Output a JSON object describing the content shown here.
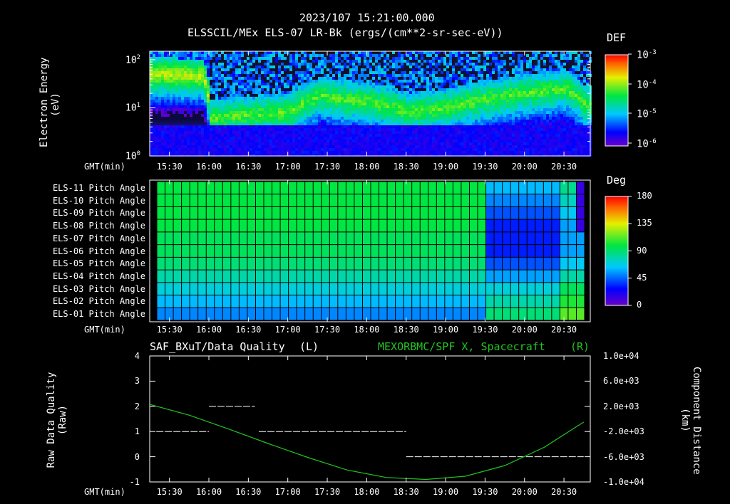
{
  "header": {
    "timestamp": "2023/107 15:21:00.000",
    "title": "ELSSCIL/MEx ELS-07 LR-Bk  (ergs/(cm**2-sr-sec-eV))"
  },
  "chart_data": [
    {
      "type": "heatmap",
      "title": "ELSSCIL/MEx ELS-07 LR-Bk  (ergs/(cm**2-sr-sec-eV))",
      "xlabel": "GMT(min)",
      "ylabel": "Electron Energy (eV)",
      "yscale": "log",
      "ylim": [
        1,
        150
      ],
      "y_ticks": [
        "10^2",
        "10^1",
        "10^0"
      ],
      "x_ticks": [
        "15:30",
        "16:00",
        "16:30",
        "17:00",
        "17:30",
        "18:00",
        "18:30",
        "19:00",
        "19:30",
        "20:00",
        "20:30"
      ],
      "colorbar": {
        "label": "DEF",
        "ticks": [
          "10^-3",
          "10^-4",
          "10^-5",
          "10^-6"
        ]
      },
      "peak_energy_trace": [
        {
          "t": "15:15",
          "e": 50
        },
        {
          "t": "15:55",
          "e": 45
        },
        {
          "t": "16:00",
          "e": 6
        },
        {
          "t": "17:00",
          "e": 8
        },
        {
          "t": "17:25",
          "e": 18
        },
        {
          "t": "17:40",
          "e": 15
        },
        {
          "t": "18:10",
          "e": 12
        },
        {
          "t": "18:30",
          "e": 8
        },
        {
          "t": "19:00",
          "e": 10
        },
        {
          "t": "19:30",
          "e": 15
        },
        {
          "t": "20:00",
          "e": 20
        },
        {
          "t": "20:30",
          "e": 25
        },
        {
          "t": "20:45",
          "e": 12
        }
      ]
    },
    {
      "type": "heatmap",
      "xlabel": "GMT(min)",
      "rows": [
        "ELS-11 Pitch Angle",
        "ELS-10 Pitch Angle",
        "ELS-09 Pitch Angle",
        "ELS-08 Pitch Angle",
        "ELS-07 Pitch Angle",
        "ELS-06 Pitch Angle",
        "ELS-05 Pitch Angle",
        "ELS-04 Pitch Angle",
        "ELS-03 Pitch Angle",
        "ELS-02 Pitch Angle",
        "ELS-01 Pitch Angle"
      ],
      "x_ticks": [
        "15:30",
        "16:00",
        "16:30",
        "17:00",
        "17:30",
        "18:00",
        "18:30",
        "19:00",
        "19:30",
        "20:00",
        "20:30"
      ],
      "colorbar": {
        "label": "Deg",
        "ticks": [
          "180",
          "135",
          "90",
          "45",
          "0"
        ],
        "range": [
          0,
          180
        ]
      },
      "values_before_19_30": [
        100,
        100,
        100,
        100,
        95,
        95,
        90,
        80,
        70,
        60,
        50
      ],
      "values_after_19_40": [
        60,
        50,
        40,
        30,
        30,
        30,
        40,
        55,
        70,
        80,
        90
      ]
    },
    {
      "type": "line",
      "title_left": "SAF_BXuT/Data Quality (L)",
      "title_right": "MEXORBMC/SPF X, Spacecraft (R)",
      "xlabel": "GMT(min)",
      "ylabel_left": "Raw Data Quality (Raw)",
      "ylabel_right": "Component Distance (km)",
      "ylim_left": [
        -1,
        4
      ],
      "ylim_right": [
        -10000,
        10000
      ],
      "y_ticks_left": [
        "4",
        "3",
        "2",
        "1",
        "0",
        "-1"
      ],
      "y_ticks_right": [
        "1.0e+04",
        "6.0e+03",
        "2.0e+03",
        "-2.0e+03",
        "-6.0e+03",
        "-1.0e+04"
      ],
      "x_ticks": [
        "15:30",
        "16:00",
        "16:30",
        "17:00",
        "17:30",
        "18:00",
        "18:30",
        "19:00",
        "19:30",
        "20:00",
        "20:30"
      ],
      "series": [
        {
          "name": "SAF_BXuT/Data Quality",
          "axis": "left",
          "color": "#ffffff",
          "segments": [
            {
              "t0": "15:20",
              "t1": "16:00",
              "v": 1
            },
            {
              "t0": "16:00",
              "t1": "16:35",
              "v": 2
            },
            {
              "t0": "16:38",
              "t1": "18:30",
              "v": 1
            },
            {
              "t0": "18:30",
              "t1": "20:45",
              "v": 0
            }
          ]
        },
        {
          "name": "MEXORBMC/SPF X, Spacecraft",
          "axis": "right",
          "color": "#22c322",
          "x": [
            "15:15",
            "15:45",
            "16:15",
            "16:45",
            "17:15",
            "17:45",
            "18:15",
            "18:45",
            "19:15",
            "19:45",
            "20:15",
            "20:45"
          ],
          "y": [
            2300,
            600,
            -1600,
            -3900,
            -6100,
            -8100,
            -9300,
            -9600,
            -9100,
            -7400,
            -4500,
            -500
          ]
        }
      ]
    }
  ]
}
